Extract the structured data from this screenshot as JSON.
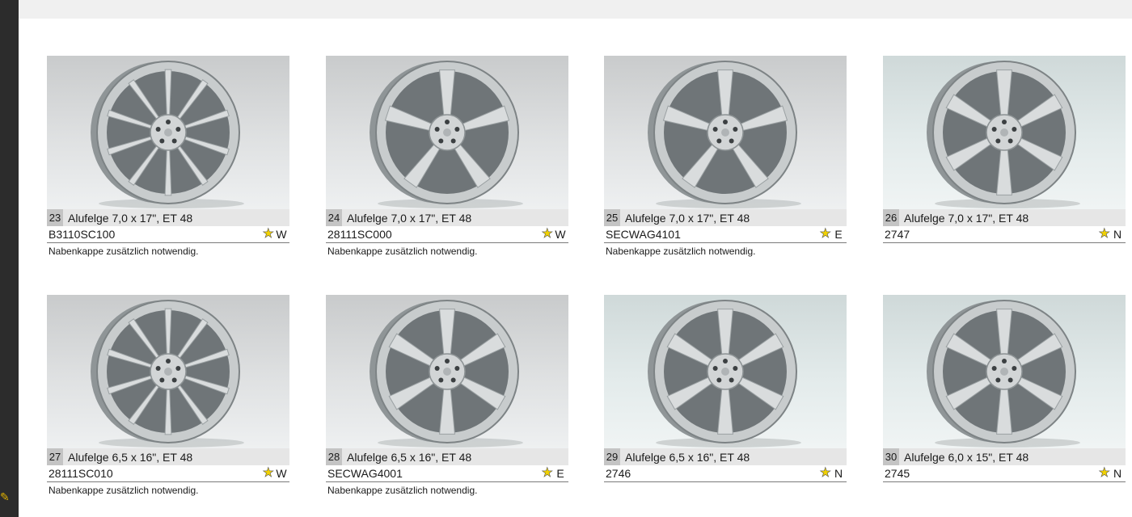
{
  "products": [
    {
      "num": "23",
      "title": "Alufelge 7,0 x 17\", ET 48",
      "code": "B3110SC100",
      "mark": "W",
      "note": "Nabenkappe zusätzlich notwendig.",
      "style": "split",
      "bg": "grey"
    },
    {
      "num": "24",
      "title": "Alufelge 7,0 x 17\", ET 48",
      "code": "28111SC000",
      "mark": "W",
      "note": "Nabenkappe zusätzlich notwendig.",
      "style": "five",
      "bg": "grey"
    },
    {
      "num": "25",
      "title": "Alufelge 7,0 x 17\", ET 48",
      "code": "SECWAG4101",
      "mark": "E",
      "note": "Nabenkappe zusätzlich notwendig.",
      "style": "five",
      "bg": "grey"
    },
    {
      "num": "26",
      "title": "Alufelge 7,0 x 17\", ET 48",
      "code": "2747",
      "mark": "N",
      "note": "",
      "style": "six",
      "bg": "light"
    },
    {
      "num": "27",
      "title": "Alufelge 6,5 x 16\", ET 48",
      "code": "28111SC010",
      "mark": "W",
      "note": "Nabenkappe zusätzlich notwendig.",
      "style": "double",
      "bg": "grey"
    },
    {
      "num": "28",
      "title": "Alufelge 6,5 x 16\", ET 48",
      "code": "SECWAG4001",
      "mark": "E",
      "note": "Nabenkappe zusätzlich notwendig.",
      "style": "six",
      "bg": "grey"
    },
    {
      "num": "29",
      "title": "Alufelge 6,5 x 16\", ET 48",
      "code": "2746",
      "mark": "N",
      "note": "",
      "style": "six",
      "bg": "light"
    },
    {
      "num": "30",
      "title": "Alufelge 6,0 x 15\", ET 48",
      "code": "2745",
      "mark": "N",
      "note": "",
      "style": "six",
      "bg": "light"
    }
  ],
  "colors": {
    "star": "#f2d200",
    "title_bar": "#e6e6e6",
    "num_box": "#c4c4c4"
  }
}
